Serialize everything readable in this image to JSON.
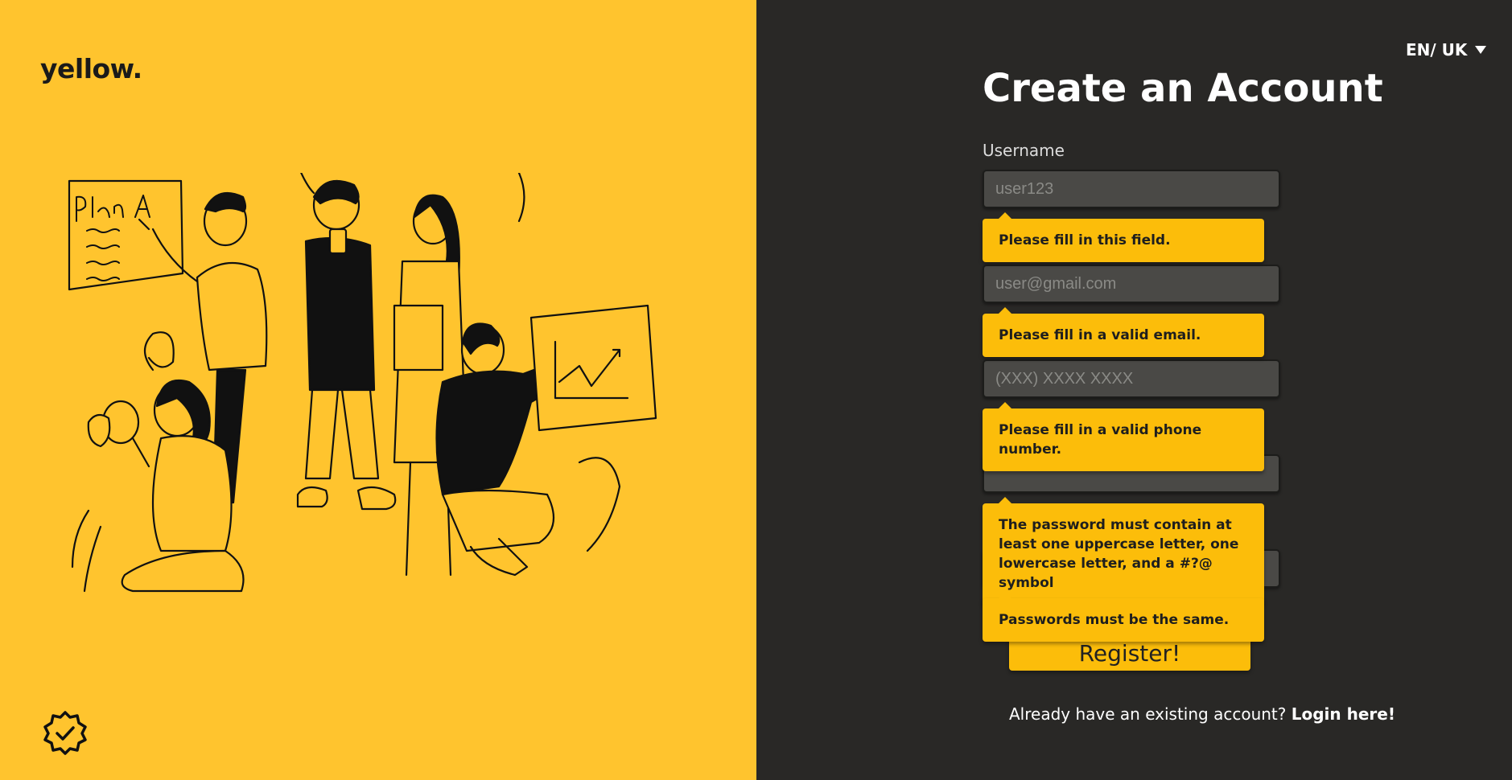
{
  "brand": {
    "logo_text": "yellow."
  },
  "language": {
    "selected": "EN/ UK"
  },
  "form": {
    "title": "Create an Account",
    "username_label": "Username",
    "username_placeholder": "user123",
    "email_placeholder": "user@gmail.com",
    "phone_placeholder": "(XXX) XXXX XXXX",
    "password_value": "",
    "confirm_value": "",
    "register_label": "Register!"
  },
  "validation": {
    "username": "Please fill in this field.",
    "email": "Please fill in a valid email.",
    "phone": "Please fill in a valid phone number.",
    "password": "The password must contain at least one uppercase letter, one lowercase letter, and a #?@ symbol",
    "confirm": "Passwords must be the same."
  },
  "footer": {
    "prompt": "Already have an existing account?",
    "login_link": "Login here!"
  },
  "colors": {
    "left_panel": "#ffc42e",
    "right_panel": "#292826",
    "accent": "#fcbd0a",
    "input_bg": "#4a4946"
  },
  "icons": {
    "badge": "verified-badge-icon",
    "language": "caret-down-icon",
    "illustration": "team-planning-illustration"
  }
}
